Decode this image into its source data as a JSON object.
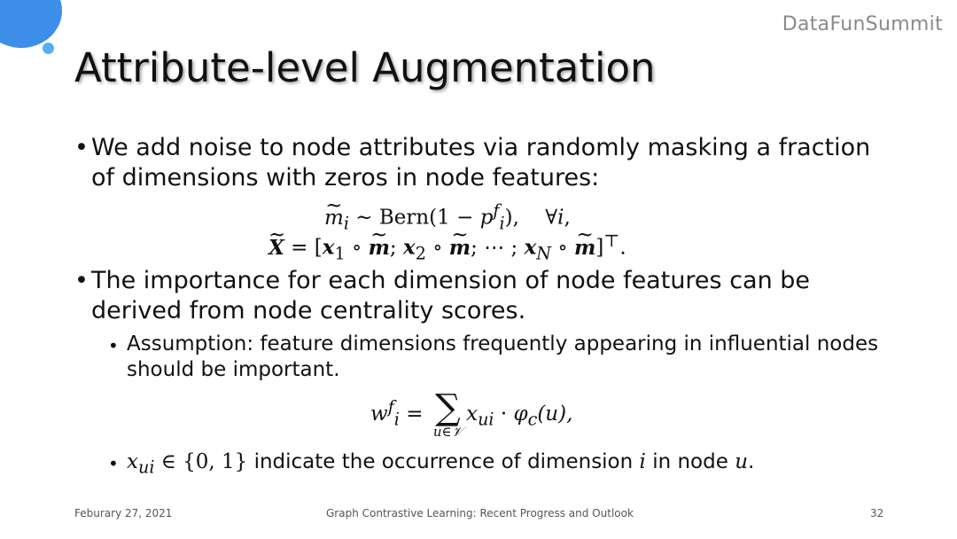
{
  "brand": "DataFunSummit",
  "title": "Attribute-level Augmentation",
  "bullets": {
    "b1": {
      "marker": "•",
      "text": "We add noise to node attributes via randomly masking a fraction of dimensions with zeros in node features:"
    },
    "b2": {
      "marker": "•",
      "text": "The importance for each dimension of node features can be derived from node centrality scores."
    },
    "b3": {
      "marker": "•",
      "text": "Assumption: feature dimensions frequently appearing in influential nodes should be important."
    },
    "b4": {
      "marker": "•",
      "pre": "x",
      "pre_sub": "ui",
      "set": " ∈ {0, 1}",
      "text_a": " indicate the occurrence of dimension ",
      "var_i": "i",
      "text_b": " in node ",
      "var_u": "u",
      "text_c": "."
    }
  },
  "equations": {
    "eq1": {
      "lhs": "m",
      "lhs_sub": "i",
      "rel": " ∼ ",
      "fn": "Bern(1 − ",
      "p": "p",
      "p_sub": "i",
      "p_sup": "f",
      "close": "),",
      "gap": "    ",
      "forall": "∀",
      "forall_var": "i",
      "end": ","
    },
    "eq2": {
      "lhs": "X",
      "eq": " = [",
      "x1": "x",
      "x1_sub": "1",
      "op": " ∘ ",
      "m": "m",
      "sep1": "; ",
      "x2": "x",
      "x2_sub": "2",
      "sep2": "; ",
      "dots": "⋯",
      "sep3": " ; ",
      "xn": "x",
      "xn_sub": "N",
      "close": "]",
      "transpose": "⊤",
      "end": "."
    },
    "eq3": {
      "w": "w",
      "w_sub": "i",
      "w_sup": "f",
      "eq": " = ",
      "sum": "∑",
      "sum_sub": "u∈𝒱",
      "x": "x",
      "x_sub": "ui",
      "dot": " · ",
      "phi": "φ",
      "phi_sub": "c",
      "arg": "(u),"
    }
  },
  "footer": {
    "date": "Feburary 27, 2021",
    "talk_title": "Graph Contrastive Learning: Recent Progress and Outlook",
    "page_number": "32"
  },
  "colors": {
    "accent_circle": "#3d8ee8",
    "accent_dot": "#57aef4",
    "brand_text": "#8a8a8a"
  }
}
